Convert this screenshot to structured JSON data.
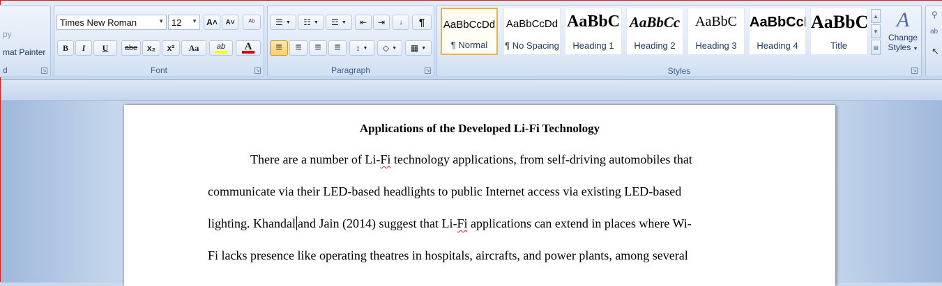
{
  "clipboard": {
    "copy_label": "py",
    "format_painter_label": "mat Painter",
    "group_label": "d"
  },
  "font": {
    "group_label": "Font",
    "font_name": "Times New Roman",
    "font_size": "12",
    "bold": "B",
    "italic": "I",
    "underline": "U",
    "strike": "abe",
    "subscript": "x₂",
    "superscript": "x²",
    "change_case": "Aa",
    "grow": "A˄",
    "shrink": "A˅",
    "highlight": "ab",
    "font_color": "A",
    "highlight_color": "#ffff00",
    "font_color_value": "#e00000"
  },
  "paragraph": {
    "group_label": "Paragraph",
    "bullets": "☰",
    "numbering": "☷",
    "multilevel": "☲",
    "decrease_indent": "⇤",
    "increase_indent": "⇥",
    "sort": "↓",
    "show_marks": "¶",
    "align_left": "≡",
    "align_center": "≡",
    "align_right": "≡",
    "justify": "≡",
    "line_spacing": "↕",
    "shading": "◇",
    "borders": "▦"
  },
  "styles": {
    "group_label": "Styles",
    "items": [
      {
        "preview": "AaBbCcDd",
        "name": "¶ Normal"
      },
      {
        "preview": "AaBbCcDd",
        "name": "¶ No Spacing"
      },
      {
        "preview": "AaBbC",
        "name": "Heading 1"
      },
      {
        "preview": "AaBbCc",
        "name": "Heading 2"
      },
      {
        "preview": "AaBbC",
        "name": "Heading 3"
      },
      {
        "preview": "AaBbCcI",
        "name": "Heading 4"
      },
      {
        "preview": "AaBbC",
        "name": "Title"
      }
    ],
    "change_styles_label_1": "Change",
    "change_styles_label_2": "Styles",
    "change_styles_glyph": "A"
  },
  "document": {
    "title": "Applications  of the Developed Li-Fi Technology",
    "line1_a": "There are a number of Li-",
    "line1_fi": "Fi",
    "line1_b": " technology applications, from self-driving automobiles that",
    "line2": "communicate via their LED-based headlights to public Internet access via existing LED-based",
    "line3_a": "lighting. Khandal",
    "line3_b": "and Jain (2014) suggest that Li-",
    "line3_fi": "Fi",
    "line3_c": " applications can extend in places where Wi-",
    "line4": "Fi lacks presence like operating theatres in hospitals, aircrafts, and power plants, among several"
  }
}
